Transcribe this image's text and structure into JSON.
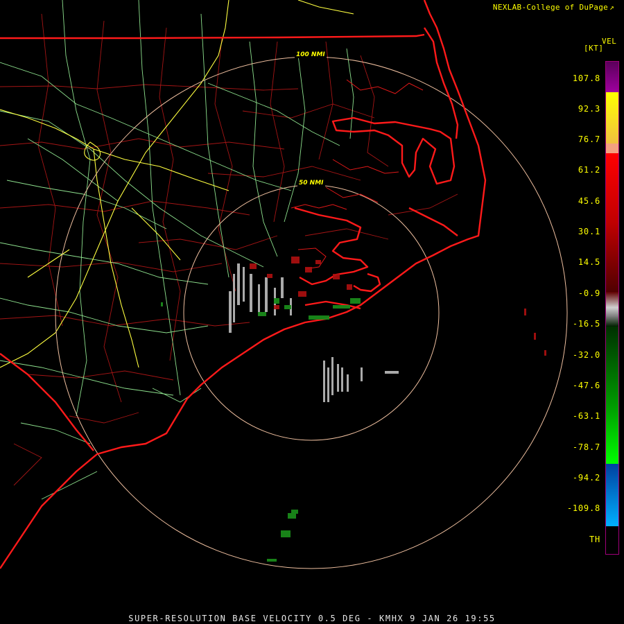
{
  "branding": {
    "text": "NEXLAB-College of DuPage",
    "icon": "external-link-icon"
  },
  "legend": {
    "product": "VEL",
    "unit": "[KT]",
    "ticks": [
      "107.8",
      "92.3",
      "76.7",
      "61.2",
      "45.6",
      "30.1",
      "14.5",
      "-0.9",
      "-16.5",
      "-32.0",
      "-47.6",
      "-63.1",
      "-78.7",
      "-94.2",
      "-109.8",
      "TH"
    ],
    "colors": {
      "purple": "#7a007a",
      "yellow": "#ffff00",
      "salmon": "#f4a080",
      "red_bright": "#ff0000",
      "red_dark": "#6a0000",
      "gray": "#b0b0b0",
      "green_dark": "#004000",
      "green_bright": "#00e000",
      "blue": "#0050c0",
      "cyan": "#00a0ff",
      "th": "#000000"
    }
  },
  "range_rings": {
    "inner_label": "50 NMI",
    "outer_label": "100 NMI"
  },
  "map_colors": {
    "state_lines": "#ff2020",
    "county_lines": "#b01010",
    "highways": "#90e890",
    "interstates": "#ffff40",
    "rings": "#f0c0a0"
  },
  "footer": {
    "text": "SUPER-RESOLUTION BASE VELOCITY 0.5 DEG - KMHX 9 JAN 26 19:55"
  }
}
